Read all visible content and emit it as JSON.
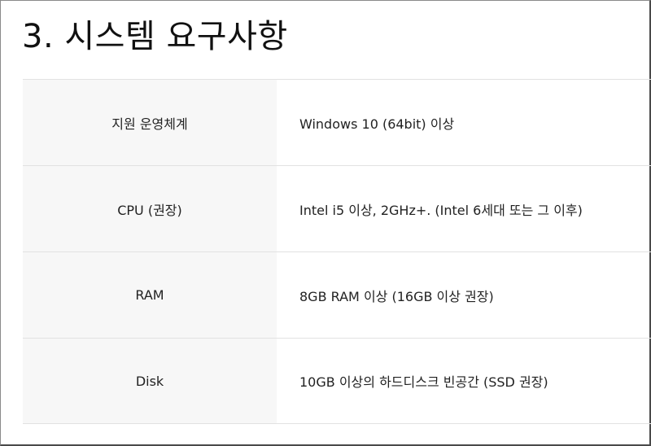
{
  "section": {
    "title": "3. 시스템 요구사항"
  },
  "requirements": [
    {
      "label": "지원 운영체계",
      "value": "Windows 10 (64bit) 이상"
    },
    {
      "label": "CPU (권장)",
      "value": "Intel i5 이상, 2GHz+. (Intel 6세대 또는 그 이후)"
    },
    {
      "label": "RAM",
      "value": "8GB RAM 이상 (16GB 이상 권장)"
    },
    {
      "label": "Disk",
      "value": "10GB 이상의 하드디스크 빈공간 (SSD 권장)"
    }
  ],
  "colors": {
    "label_background": "#f7f7f7",
    "border": "#e2e2e2",
    "text": "#222222"
  }
}
